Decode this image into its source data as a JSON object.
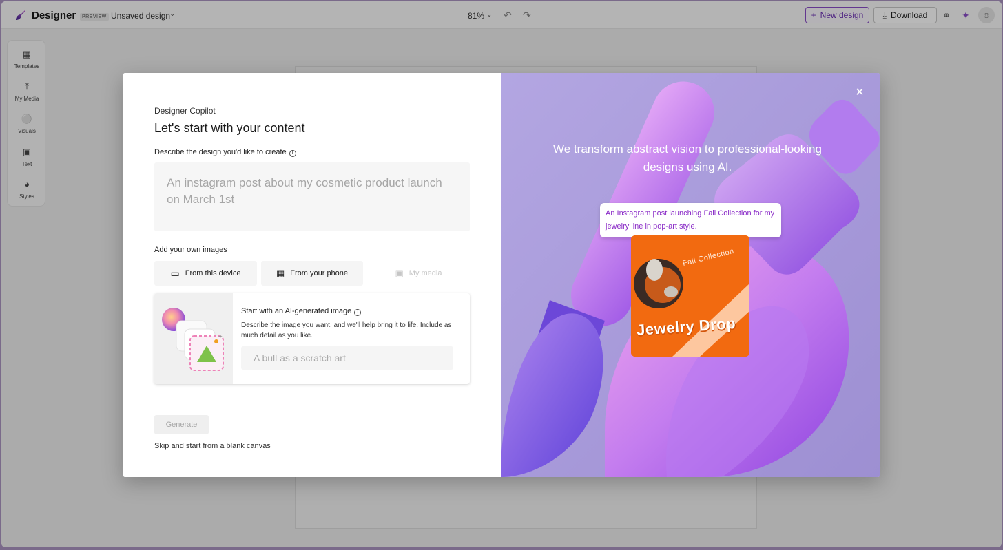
{
  "app": {
    "brand": "Designer",
    "badge": "PREVIEW",
    "design_name": "Unsaved design",
    "zoom": "81%",
    "new_design_label": "New design",
    "download_label": "Download"
  },
  "rail": {
    "items": [
      {
        "label": "Templates",
        "icon": "templates-icon"
      },
      {
        "label": "My Media",
        "icon": "upload-icon"
      },
      {
        "label": "Visuals",
        "icon": "shapes-icon"
      },
      {
        "label": "Text",
        "icon": "text-icon"
      },
      {
        "label": "Styles",
        "icon": "palette-icon"
      }
    ]
  },
  "modal": {
    "eyebrow": "Designer Copilot",
    "heading": "Let's start with your content",
    "describe_label": "Describe the design you'd like to create",
    "prompt_placeholder": "An instagram post about my cosmetic product launch on March 1st",
    "add_images_label": "Add your own images",
    "image_buttons": {
      "device": "From this device",
      "phone": "From your phone",
      "media": "My media"
    },
    "ai_card": {
      "title": "Start with an AI-generated image",
      "description": "Describe the image you want, and we'll help bring it to life. Include as much detail as you like.",
      "placeholder": "A bull as a scratch art"
    },
    "generate_label": "Generate",
    "skip_prefix": "Skip and start from ",
    "skip_link": "a blank canvas"
  },
  "hero": {
    "tagline": "We transform abstract vision to professional-looking designs using AI.",
    "example_prompt": "An Instagram post launching Fall Collection for my jewelry line in pop-art style.",
    "poster_subtitle": "Fall Collection",
    "poster_title": "Jewelry Drop"
  },
  "colors": {
    "accent": "#6b2fb3",
    "hero_bg": "#a89ad8",
    "poster_orange": "#f26a10"
  }
}
